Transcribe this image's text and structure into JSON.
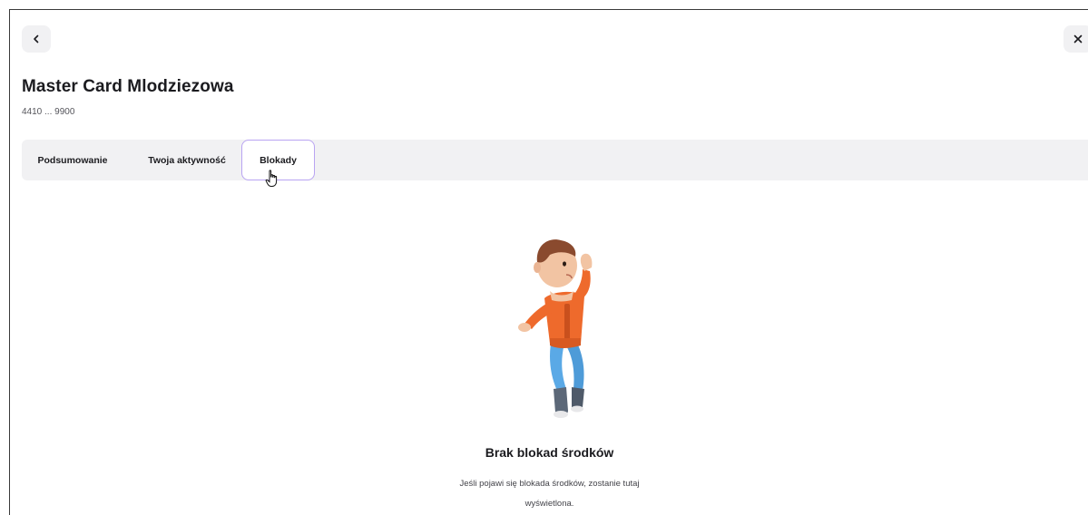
{
  "header": {
    "back_icon": "chevron-left-icon",
    "close_icon": "close-icon",
    "title": "Master Card Mlodziezowa",
    "card_number": "4410 ... 9900"
  },
  "tabs": [
    {
      "label": "Podsumowanie",
      "active": false
    },
    {
      "label": "Twoja aktywność",
      "active": false
    },
    {
      "label": "Blokady",
      "active": true
    }
  ],
  "empty_state": {
    "illustration": "boy-character-illustration",
    "title": "Brak blokad środków",
    "description_line1": "Jeśli pojawi się blokada środków, zostanie tutaj",
    "description_line2": "wyświetlona."
  },
  "colors": {
    "tab_bar_bg": "#f1f1f3",
    "active_tab_border": "#b9a4f2",
    "shirt": "#ee6a2c",
    "jeans": "#5aa9e6"
  }
}
